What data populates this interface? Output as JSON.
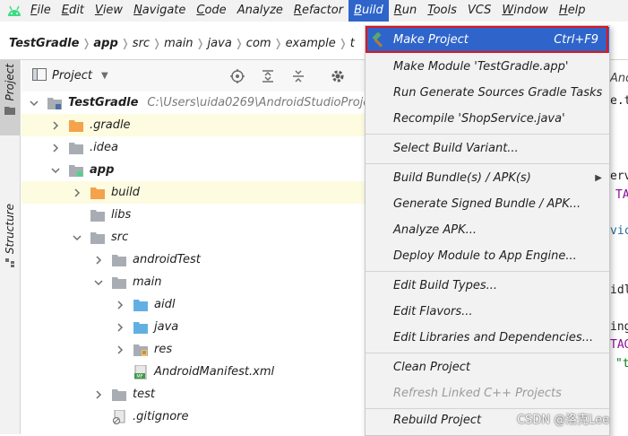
{
  "menubar": {
    "items": [
      {
        "label": "File",
        "mnemonic": "F",
        "rest": "ile"
      },
      {
        "label": "Edit",
        "mnemonic": "E",
        "rest": "dit"
      },
      {
        "label": "View",
        "mnemonic": "V",
        "rest": "iew"
      },
      {
        "label": "Navigate",
        "mnemonic": "N",
        "rest": "avigate"
      },
      {
        "label": "Code",
        "mnemonic": "C",
        "rest": "ode"
      },
      {
        "label": "Analyze",
        "mnemonic": "",
        "rest": "Analyze"
      },
      {
        "label": "Refactor",
        "mnemonic": "R",
        "rest": "efactor"
      },
      {
        "label": "Build",
        "mnemonic": "B",
        "rest": "uild"
      },
      {
        "label": "Run",
        "mnemonic": "R",
        "rest": "un"
      },
      {
        "label": "Tools",
        "mnemonic": "T",
        "rest": "ools"
      },
      {
        "label": "VCS",
        "mnemonic": "",
        "rest": "VCS"
      },
      {
        "label": "Window",
        "mnemonic": "W",
        "rest": "indow"
      },
      {
        "label": "Help",
        "mnemonic": "H",
        "rest": "elp"
      }
    ],
    "active": "Build"
  },
  "breadcrumb": [
    "TestGradle",
    "app",
    "src",
    "main",
    "java",
    "com",
    "example",
    "t"
  ],
  "tool_strip": {
    "project": "Project",
    "structure": "Structure"
  },
  "project_panel": {
    "title": "Project"
  },
  "tree": [
    {
      "label": "TestGradle",
      "path": "C:\\Users\\uida0269\\AndroidStudioProje",
      "icon": "module-folder-icon"
    },
    {
      "label": ".gradle",
      "icon": "orange-folder-icon"
    },
    {
      "label": ".idea",
      "icon": "gray-folder-icon"
    },
    {
      "label": "app",
      "icon": "module-folder-icon"
    },
    {
      "label": "build",
      "icon": "orange-folder-icon"
    },
    {
      "label": "libs",
      "icon": "gray-folder-icon"
    },
    {
      "label": "src",
      "icon": "gray-folder-icon"
    },
    {
      "label": "androidTest",
      "icon": "gray-folder-icon"
    },
    {
      "label": "main",
      "icon": "gray-folder-icon"
    },
    {
      "label": "aidl",
      "icon": "blue-folder-icon"
    },
    {
      "label": "java",
      "icon": "blue-folder-icon"
    },
    {
      "label": "res",
      "icon": "res-folder-icon"
    },
    {
      "label": "AndroidManifest.xml",
      "icon": "manifest-file-icon"
    },
    {
      "label": "test",
      "icon": "gray-folder-icon"
    },
    {
      "label": ".gitignore",
      "icon": "gitignore-file-icon"
    }
  ],
  "build_menu": {
    "items": [
      {
        "label": "Make Project",
        "shortcut": "Ctrl+F9"
      },
      {
        "label": "Make Module 'TestGradle.app'"
      },
      {
        "label": "Run Generate Sources Gradle Tasks"
      },
      {
        "label": "Recompile 'ShopService.java'"
      },
      {
        "label": "Select Build Variant..."
      },
      {
        "label": "Build Bundle(s) / APK(s)"
      },
      {
        "label": "Generate Signed Bundle / APK..."
      },
      {
        "label": "Analyze APK..."
      },
      {
        "label": "Deploy Module to App Engine..."
      },
      {
        "label": "Edit Build Types..."
      },
      {
        "label": "Edit Flavors..."
      },
      {
        "label": "Edit Libraries and Dependencies..."
      },
      {
        "label": "Clean Project"
      },
      {
        "label": "Refresh Linked C++ Projects"
      },
      {
        "label": "Rebuild Project"
      }
    ]
  },
  "editor_fragments": {
    "tab": "And",
    "l1": "e.t",
    "l2": "erv",
    "l3": "TA",
    "l4": "vic",
    "l5": "idl",
    "l6": "ing",
    "l7": "TAG",
    "l8": "\"t"
  },
  "watermark": "CSDN @洛克Lee",
  "colors": {
    "menu_selected": "#2f65ca",
    "highlight_border": "#e0151b",
    "row_highlight": "#fdfbe0",
    "folder_orange": "#f4a24b",
    "folder_blue": "#62b0e3",
    "folder_gray": "#a8adb3"
  }
}
